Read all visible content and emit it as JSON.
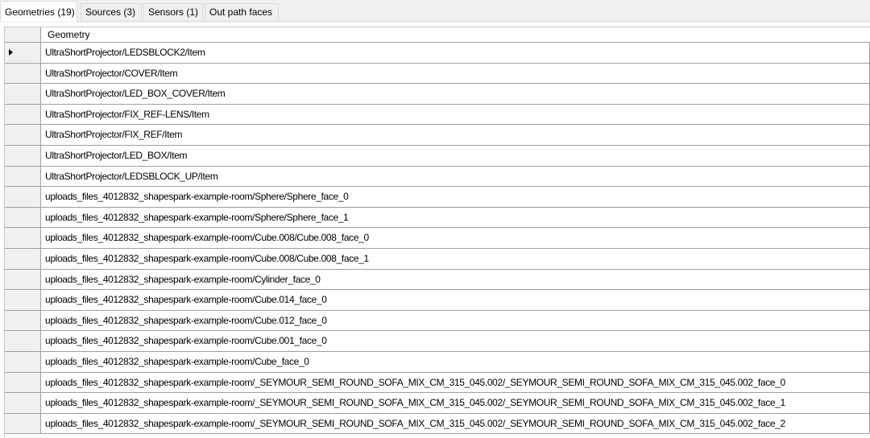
{
  "tabs": [
    {
      "label": "Geometries (19)",
      "active": true
    },
    {
      "label": "Sources (3)",
      "active": false
    },
    {
      "label": "Sensors (1)",
      "active": false
    },
    {
      "label": "Out path faces",
      "active": false
    }
  ],
  "grid": {
    "column_header": "Geometry",
    "selected_row": 0,
    "rows": [
      "UltraShortProjector/LEDSBLOCK2/Item",
      "UltraShortProjector/COVER/Item",
      "UltraShortProjector/LED_BOX_COVER/Item",
      "UltraShortProjector/FIX_REF-LENS/Item",
      "UltraShortProjector/FIX_REF/Item",
      "UltraShortProjector/LED_BOX/Item",
      "UltraShortProjector/LEDSBLOCK_UP/Item",
      "uploads_files_4012832_shapespark-example-room/Sphere/Sphere_face_0",
      "uploads_files_4012832_shapespark-example-room/Sphere/Sphere_face_1",
      "uploads_files_4012832_shapespark-example-room/Cube.008/Cube.008_face_0",
      "uploads_files_4012832_shapespark-example-room/Cube.008/Cube.008_face_1",
      "uploads_files_4012832_shapespark-example-room/Cylinder_face_0",
      "uploads_files_4012832_shapespark-example-room/Cube.014_face_0",
      "uploads_files_4012832_shapespark-example-room/Cube.012_face_0",
      "uploads_files_4012832_shapespark-example-room/Cube.001_face_0",
      "uploads_files_4012832_shapespark-example-room/Cube_face_0",
      "uploads_files_4012832_shapespark-example-room/_SEYMOUR_SEMI_ROUND_SOFA_MIX_CM_315_045.002/_SEYMOUR_SEMI_ROUND_SOFA_MIX_CM_315_045.002_face_0",
      "uploads_files_4012832_shapespark-example-room/_SEYMOUR_SEMI_ROUND_SOFA_MIX_CM_315_045.002/_SEYMOUR_SEMI_ROUND_SOFA_MIX_CM_315_045.002_face_1",
      "uploads_files_4012832_shapespark-example-room/_SEYMOUR_SEMI_ROUND_SOFA_MIX_CM_315_045.002/_SEYMOUR_SEMI_ROUND_SOFA_MIX_CM_315_045.002_face_2"
    ]
  }
}
